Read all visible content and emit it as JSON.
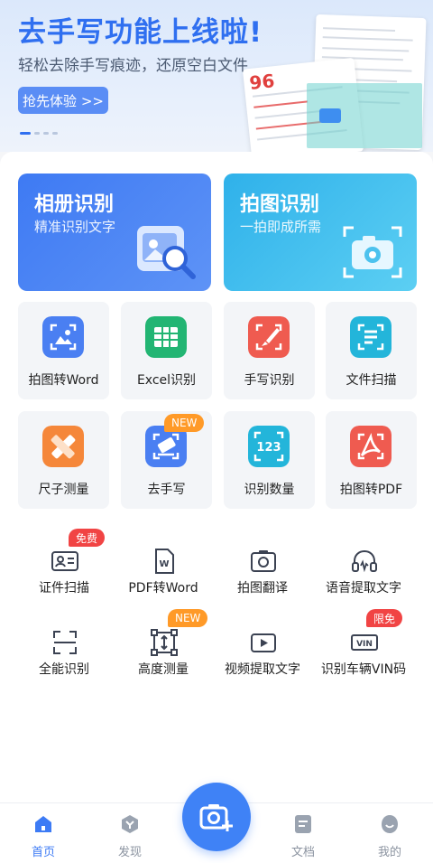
{
  "banner": {
    "title": "去手写功能上线啦!",
    "subtitle": "轻松去除手写痕迹，还原空白文件",
    "button": "抢先体验 >>"
  },
  "big_cards": [
    {
      "title": "相册识别",
      "subtitle": "精准识别文字",
      "icon": "album-search-icon"
    },
    {
      "title": "拍图识别",
      "subtitle": "一拍即成所需",
      "icon": "camera-scan-icon"
    }
  ],
  "tiles_row1": [
    {
      "label": "拍图转Word",
      "icon": "image-to-word-icon",
      "color": "#4a7ff2"
    },
    {
      "label": "Excel识别",
      "icon": "excel-icon",
      "color": "#22b573"
    },
    {
      "label": "手写识别",
      "icon": "brush-icon",
      "color": "#ef5b50"
    },
    {
      "label": "文件扫描",
      "icon": "file-scan-icon",
      "color": "#23b5da"
    }
  ],
  "tiles_row2": [
    {
      "label": "尺子测量",
      "icon": "ruler-icon",
      "color": "#f5873a"
    },
    {
      "label": "去手写",
      "icon": "eraser-icon",
      "color": "#4a7ff2",
      "badge": "NEW"
    },
    {
      "label": "识别数量",
      "icon": "count-icon",
      "color": "#23b5da"
    },
    {
      "label": "拍图转PDF",
      "icon": "pdf-icon",
      "color": "#ef5b50"
    }
  ],
  "small_row1": [
    {
      "label": "证件扫描",
      "icon": "id-card-icon",
      "badge": "免费"
    },
    {
      "label": "PDF转Word",
      "icon": "pdf-to-word-icon"
    },
    {
      "label": "拍图翻译",
      "icon": "translate-icon"
    },
    {
      "label": "语音提取文字",
      "icon": "audio-text-icon"
    }
  ],
  "small_row2": [
    {
      "label": "全能识别",
      "icon": "scan-all-icon"
    },
    {
      "label": "高度测量",
      "icon": "height-measure-icon",
      "badge": "NEW"
    },
    {
      "label": "视频提取文字",
      "icon": "video-text-icon"
    },
    {
      "label": "识别车辆VIN码",
      "icon": "vin-icon",
      "badge": "限免"
    }
  ],
  "nav": [
    {
      "label": "首页",
      "icon": "home-icon",
      "active": true
    },
    {
      "label": "发现",
      "icon": "discover-icon"
    },
    {
      "label": "文档",
      "icon": "document-icon"
    },
    {
      "label": "我的",
      "icon": "profile-icon"
    }
  ],
  "colors": {
    "primary": "#3d7bf5",
    "badge_new": "#ff9a28",
    "badge_red": "#f14444"
  }
}
